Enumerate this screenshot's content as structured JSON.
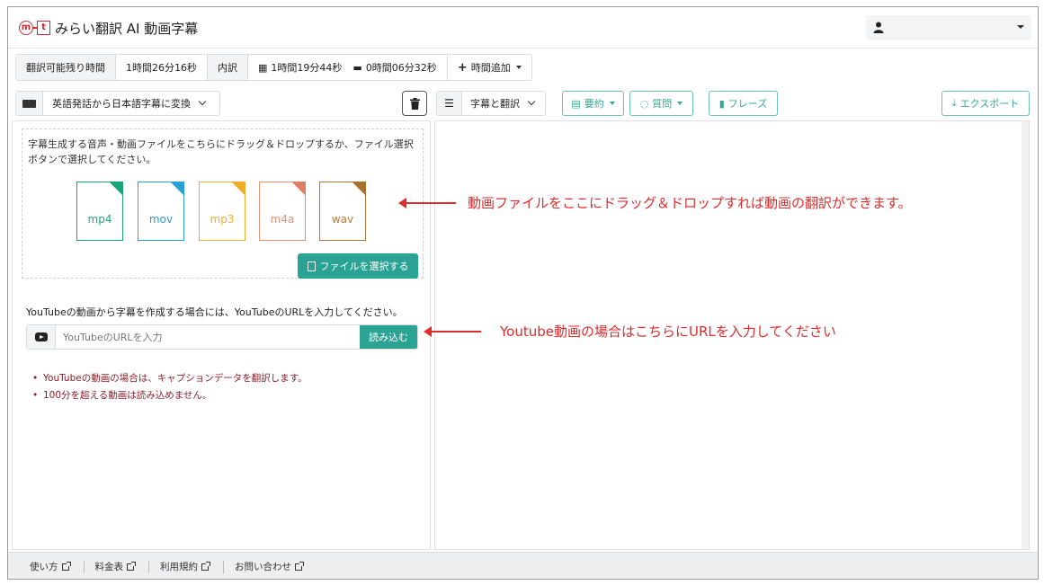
{
  "header": {
    "logo_m": "m",
    "logo_t": "t",
    "title": "みらい翻訳 AI 動画字幕"
  },
  "timebar": {
    "remaining_label": "翻訳可能残り時間",
    "remaining_value": "1時間26分16秒",
    "breakdown_label": "内訳",
    "calendar_value": "1時間19分44秒",
    "card_value": "0時間06分32秒",
    "add_time_label": "時間追加"
  },
  "toolbar": {
    "mode_label": "英語発話から日本語字幕に変換",
    "subtitle_mode_label": "字幕と翻訳",
    "summary_label": "要約",
    "question_label": "質問",
    "phrase_label": "フレーズ",
    "export_label": "エクスポート"
  },
  "drop_zone": {
    "instructions": "字幕生成する音声・動画ファイルをこちらにドラッグ＆ドロップするか、ファイル選択ボタンで選択してください。",
    "file_types": [
      {
        "label": "mp4",
        "color": "#1aa67a",
        "corner": "#17a673"
      },
      {
        "label": "mov",
        "color": "#2b9fd6",
        "corner": "#2a9fd8"
      },
      {
        "label": "mp3",
        "color": "#efae2e",
        "corner": "#f1ac2a"
      },
      {
        "label": "m4a",
        "color": "#e29376",
        "corner": "#dd7f63"
      },
      {
        "label": "wav",
        "color": "#b07a3c",
        "corner": "#a8702e"
      }
    ],
    "select_button": "ファイルを選択する"
  },
  "youtube": {
    "label": "YouTubeの動画から字幕を作成する場合には、YouTubeのURLを入力してください。",
    "placeholder": "YouTubeのURLを入力",
    "load_button": "読み込む"
  },
  "notes": [
    "YouTubeの動画の場合は、キャプションデータを翻訳します。",
    "100分を超える動画は読み込めません。"
  ],
  "footer": {
    "links": [
      "使い方",
      "料金表",
      "利用規約",
      "お問い合わせ"
    ]
  },
  "annotations": {
    "drop_hint": "動画ファイルをここにドラッグ＆ドロップすれば動画の翻訳ができます。",
    "youtube_hint": "Youtube動画の場合はこちらにURLを入力してください"
  },
  "colors": {
    "accent": "#2aa394",
    "annotation": "#e02b2b",
    "brand": "#d7262c"
  }
}
